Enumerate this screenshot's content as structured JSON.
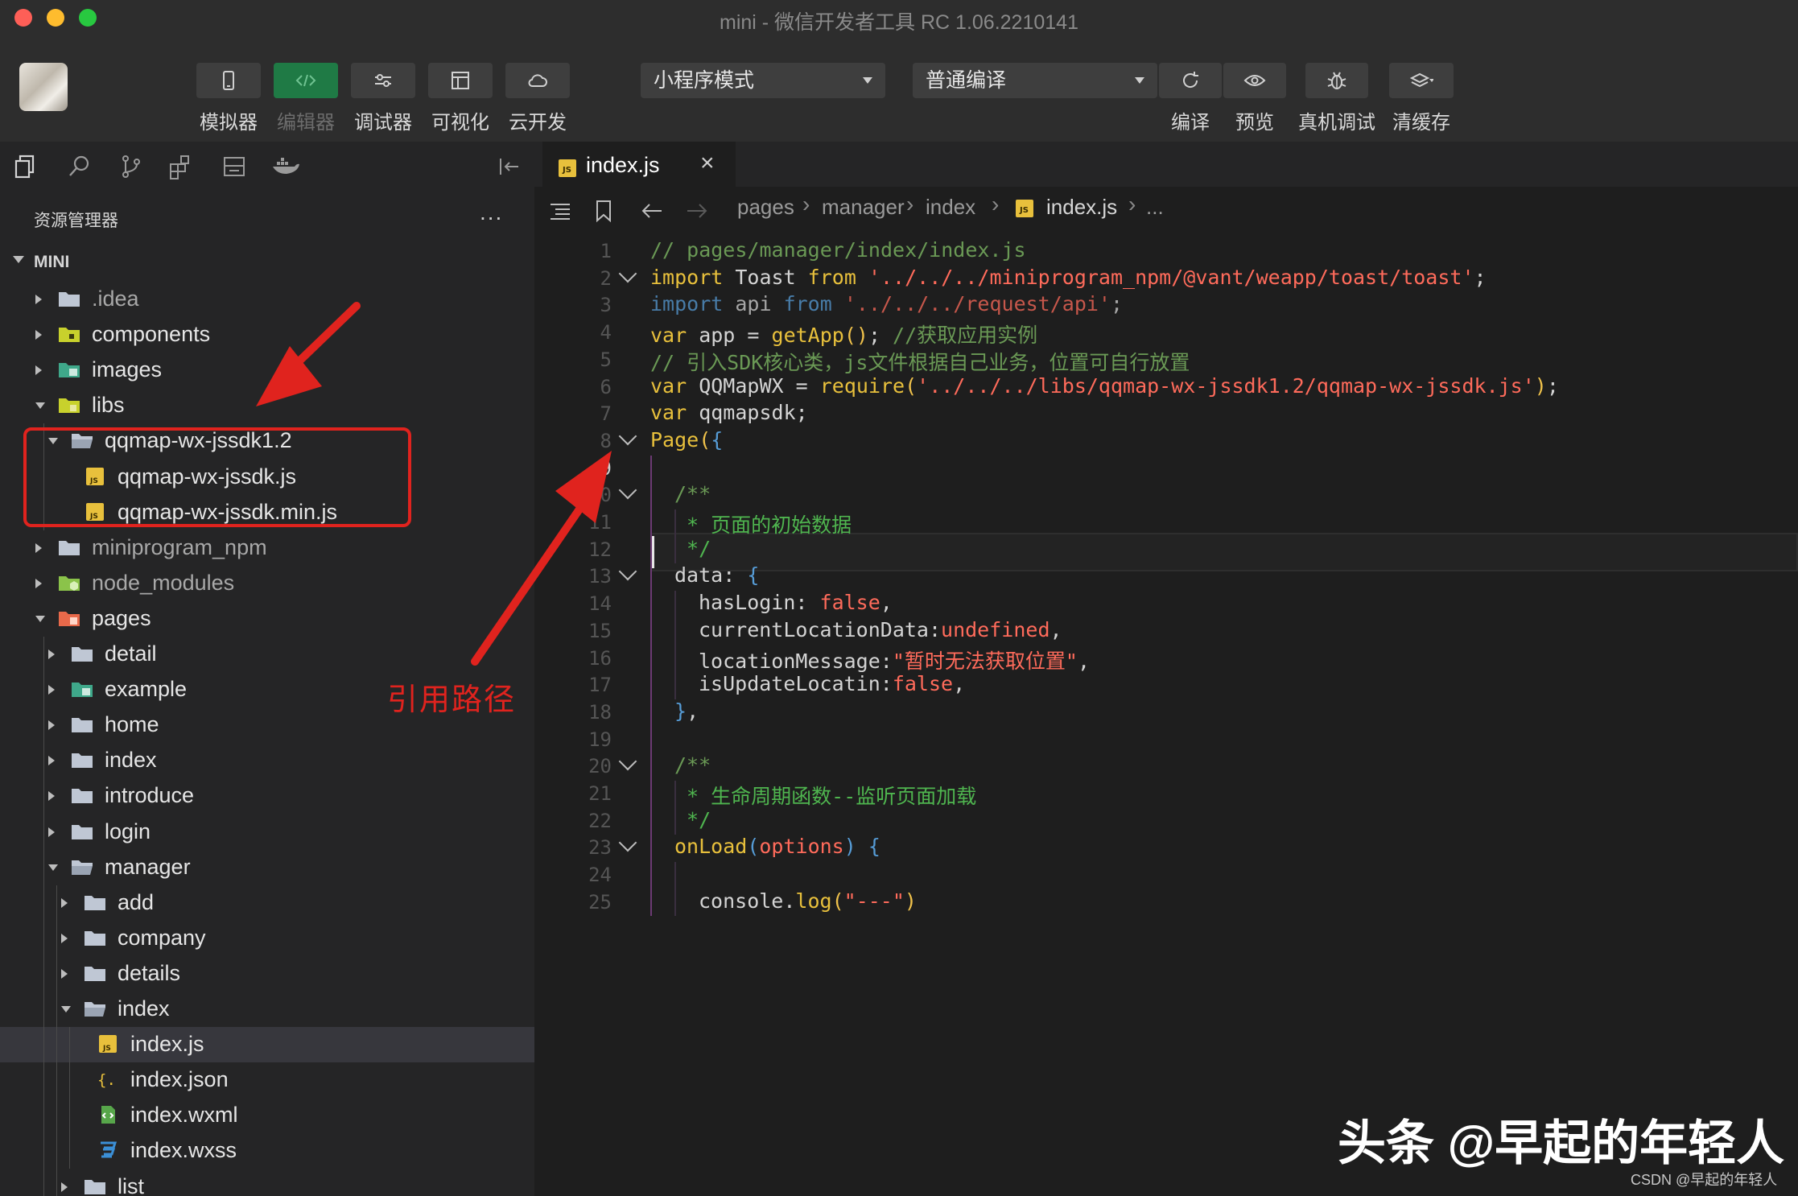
{
  "window": {
    "title": "mini - 微信开发者工具 RC 1.06.2210141"
  },
  "toolbar": {
    "simulator_label": "模拟器",
    "editor_label": "编辑器",
    "debugger_label": "调试器",
    "visual_label": "可视化",
    "cloud_label": "云开发",
    "mode_select": "小程序模式",
    "compile_select": "普通编译",
    "compile_label": "编译",
    "preview_label": "预览",
    "device_debug_label": "真机调试",
    "clear_cache_label": "清缓存"
  },
  "sidebar": {
    "explorer_title": "资源管理器",
    "more": "...",
    "root": "MINI",
    "tree": [
      {
        "name": ".idea",
        "level": 0,
        "state": "closed",
        "icon": "folder-icon",
        "dim": true
      },
      {
        "name": "components",
        "level": 0,
        "state": "closed",
        "icon": "components-folder-icon"
      },
      {
        "name": "images",
        "level": 0,
        "state": "closed",
        "icon": "images-folder-icon"
      },
      {
        "name": "libs",
        "level": 0,
        "state": "open",
        "icon": "libs-folder-icon"
      },
      {
        "name": "qqmap-wx-jssdk1.2",
        "level": 1,
        "state": "open",
        "icon": "folder-open-icon"
      },
      {
        "name": "qqmap-wx-jssdk.js",
        "level": 2,
        "icon": "js-file-icon"
      },
      {
        "name": "qqmap-wx-jssdk.min.js",
        "level": 2,
        "icon": "js-file-icon"
      },
      {
        "name": "miniprogram_npm",
        "level": 0,
        "state": "closed",
        "icon": "folder-icon",
        "dim": true
      },
      {
        "name": "node_modules",
        "level": 0,
        "state": "closed",
        "icon": "node-folder-icon",
        "dim": true
      },
      {
        "name": "pages",
        "level": 0,
        "state": "open",
        "icon": "pages-folder-icon"
      },
      {
        "name": "detail",
        "level": 1,
        "state": "closed",
        "icon": "folder-icon"
      },
      {
        "name": "example",
        "level": 1,
        "state": "closed",
        "icon": "images-folder-icon"
      },
      {
        "name": "home",
        "level": 1,
        "state": "closed",
        "icon": "folder-icon"
      },
      {
        "name": "index",
        "level": 1,
        "state": "closed",
        "icon": "folder-icon"
      },
      {
        "name": "introduce",
        "level": 1,
        "state": "closed",
        "icon": "folder-icon"
      },
      {
        "name": "login",
        "level": 1,
        "state": "closed",
        "icon": "folder-icon"
      },
      {
        "name": "manager",
        "level": 1,
        "state": "open",
        "icon": "folder-open-icon"
      },
      {
        "name": "add",
        "level": 2,
        "state": "closed",
        "icon": "folder-icon"
      },
      {
        "name": "company",
        "level": 2,
        "state": "closed",
        "icon": "folder-icon"
      },
      {
        "name": "details",
        "level": 2,
        "state": "closed",
        "icon": "folder-icon"
      },
      {
        "name": "index",
        "level": 2,
        "state": "open",
        "icon": "folder-open-icon"
      },
      {
        "name": "index.js",
        "level": 3,
        "icon": "js-file-icon",
        "selected": true
      },
      {
        "name": "index.json",
        "level": 3,
        "icon": "json-file-icon"
      },
      {
        "name": "index.wxml",
        "level": 3,
        "icon": "wxml-file-icon"
      },
      {
        "name": "index.wxss",
        "level": 3,
        "icon": "wxss-file-icon"
      },
      {
        "name": "list",
        "level": 2,
        "state": "closed",
        "icon": "folder-icon"
      }
    ]
  },
  "editor": {
    "tab_label": "index.js",
    "tab_close": "×",
    "breadcrumb": [
      "pages",
      "manager",
      "index",
      "index.js",
      "..."
    ],
    "current_line": 9,
    "lines": [
      {
        "n": "1",
        "fold": false,
        "tokens": [
          [
            "cm",
            "// pages/manager/index/index.js"
          ]
        ]
      },
      {
        "n": "2",
        "fold": true,
        "tokens": [
          [
            "kw",
            "import"
          ],
          [
            "pr",
            " Toast "
          ],
          [
            "kw",
            "from"
          ],
          [
            "pr",
            " "
          ],
          [
            "st",
            "'../../../miniprogram_npm/@vant/weapp/toast/toast'"
          ],
          [
            "pr",
            ";"
          ]
        ]
      },
      {
        "n": "3",
        "fold": false,
        "dim": true,
        "tokens": [
          [
            "kwb",
            "import"
          ],
          [
            "pr",
            " api "
          ],
          [
            "kwb",
            "from"
          ],
          [
            "pr",
            " "
          ],
          [
            "st",
            "'../../../request/api'"
          ],
          [
            "pr",
            ";"
          ]
        ]
      },
      {
        "n": "4",
        "fold": false,
        "tokens": [
          [
            "kw",
            "var"
          ],
          [
            "pr",
            " app = "
          ],
          [
            "fn",
            "getApp"
          ],
          [
            "br1",
            "()"
          ],
          [
            "pr",
            "; "
          ],
          [
            "cm",
            "//获取应用实例"
          ]
        ]
      },
      {
        "n": "5",
        "fold": false,
        "tokens": [
          [
            "cm",
            "// 引入SDK核心类，js文件根据自己业务，位置可自行放置"
          ]
        ]
      },
      {
        "n": "6",
        "fold": false,
        "tokens": [
          [
            "kw",
            "var"
          ],
          [
            "pr",
            " QQMapWX = "
          ],
          [
            "fn",
            "require"
          ],
          [
            "br1",
            "("
          ],
          [
            "st",
            "'../../../libs/qqmap-wx-jssdk1.2/qqmap-wx-jssdk.js'"
          ],
          [
            "br1",
            ")"
          ],
          [
            "pr",
            ";"
          ]
        ]
      },
      {
        "n": "7",
        "fold": false,
        "tokens": [
          [
            "kw",
            "var"
          ],
          [
            "pr",
            " qqmapsdk;"
          ]
        ]
      },
      {
        "n": "8",
        "fold": true,
        "tokens": [
          [
            "fn",
            "Page"
          ],
          [
            "br1",
            "("
          ],
          [
            "kwb",
            "{"
          ]
        ]
      },
      {
        "n": "9",
        "fold": false,
        "tokens": []
      },
      {
        "n": "10",
        "fold": true,
        "indent": 1,
        "tokens": [
          [
            "cm",
            "/**"
          ]
        ]
      },
      {
        "n": "11",
        "fold": false,
        "indent": 1,
        "tokens": [
          [
            "cmz",
            " * 页面的初始数据"
          ]
        ]
      },
      {
        "n": "12",
        "fold": false,
        "indent": 1,
        "tokens": [
          [
            "cmz",
            " */"
          ]
        ]
      },
      {
        "n": "13",
        "fold": true,
        "indent": 1,
        "tokens": [
          [
            "pr",
            "data: "
          ],
          [
            "kwb",
            "{"
          ]
        ]
      },
      {
        "n": "14",
        "fold": false,
        "indent": 2,
        "tokens": [
          [
            "pr",
            "hasLogin: "
          ],
          [
            "bool",
            "false"
          ],
          [
            "pr",
            ","
          ]
        ]
      },
      {
        "n": "15",
        "fold": false,
        "indent": 2,
        "tokens": [
          [
            "pr",
            "currentLocationData:"
          ],
          [
            "bool",
            "undefined"
          ],
          [
            "pr",
            ","
          ]
        ]
      },
      {
        "n": "16",
        "fold": false,
        "indent": 2,
        "tokens": [
          [
            "pr",
            "locationMessage:"
          ],
          [
            "st",
            "\"暂时无法获取位置\""
          ],
          [
            "pr",
            ","
          ]
        ]
      },
      {
        "n": "17",
        "fold": false,
        "indent": 2,
        "tokens": [
          [
            "pr",
            "isUpdateLocatin:"
          ],
          [
            "bool",
            "false"
          ],
          [
            "pr",
            ","
          ]
        ]
      },
      {
        "n": "18",
        "fold": false,
        "indent": 1,
        "tokens": [
          [
            "kwb",
            "}"
          ],
          [
            "pr",
            ","
          ]
        ]
      },
      {
        "n": "19",
        "fold": false,
        "tokens": []
      },
      {
        "n": "20",
        "fold": true,
        "indent": 1,
        "tokens": [
          [
            "cm",
            "/**"
          ]
        ]
      },
      {
        "n": "21",
        "fold": false,
        "indent": 1,
        "tokens": [
          [
            "cmz",
            " * 生命周期函数--监听页面加载"
          ]
        ]
      },
      {
        "n": "22",
        "fold": false,
        "indent": 1,
        "tokens": [
          [
            "cmz",
            " */"
          ]
        ]
      },
      {
        "n": "23",
        "fold": true,
        "indent": 1,
        "tokens": [
          [
            "fn",
            "onLoad"
          ],
          [
            "kwb",
            "("
          ],
          [
            "st",
            "options"
          ],
          [
            "kwb",
            ")"
          ],
          [
            "pr",
            " "
          ],
          [
            "kwb",
            "{"
          ]
        ]
      },
      {
        "n": "24",
        "fold": false,
        "tokens": []
      },
      {
        "n": "25",
        "fold": false,
        "indent": 2,
        "tokens": [
          [
            "pr",
            "console."
          ],
          [
            "fn",
            "log"
          ],
          [
            "br1",
            "("
          ],
          [
            "st",
            "\"---\""
          ],
          [
            "br1",
            ")"
          ]
        ]
      }
    ]
  },
  "annotation": {
    "label": "引用路径"
  },
  "watermark": {
    "main": "头条 @早起的年轻人",
    "csdn": "CSDN @早起的年轻人"
  }
}
